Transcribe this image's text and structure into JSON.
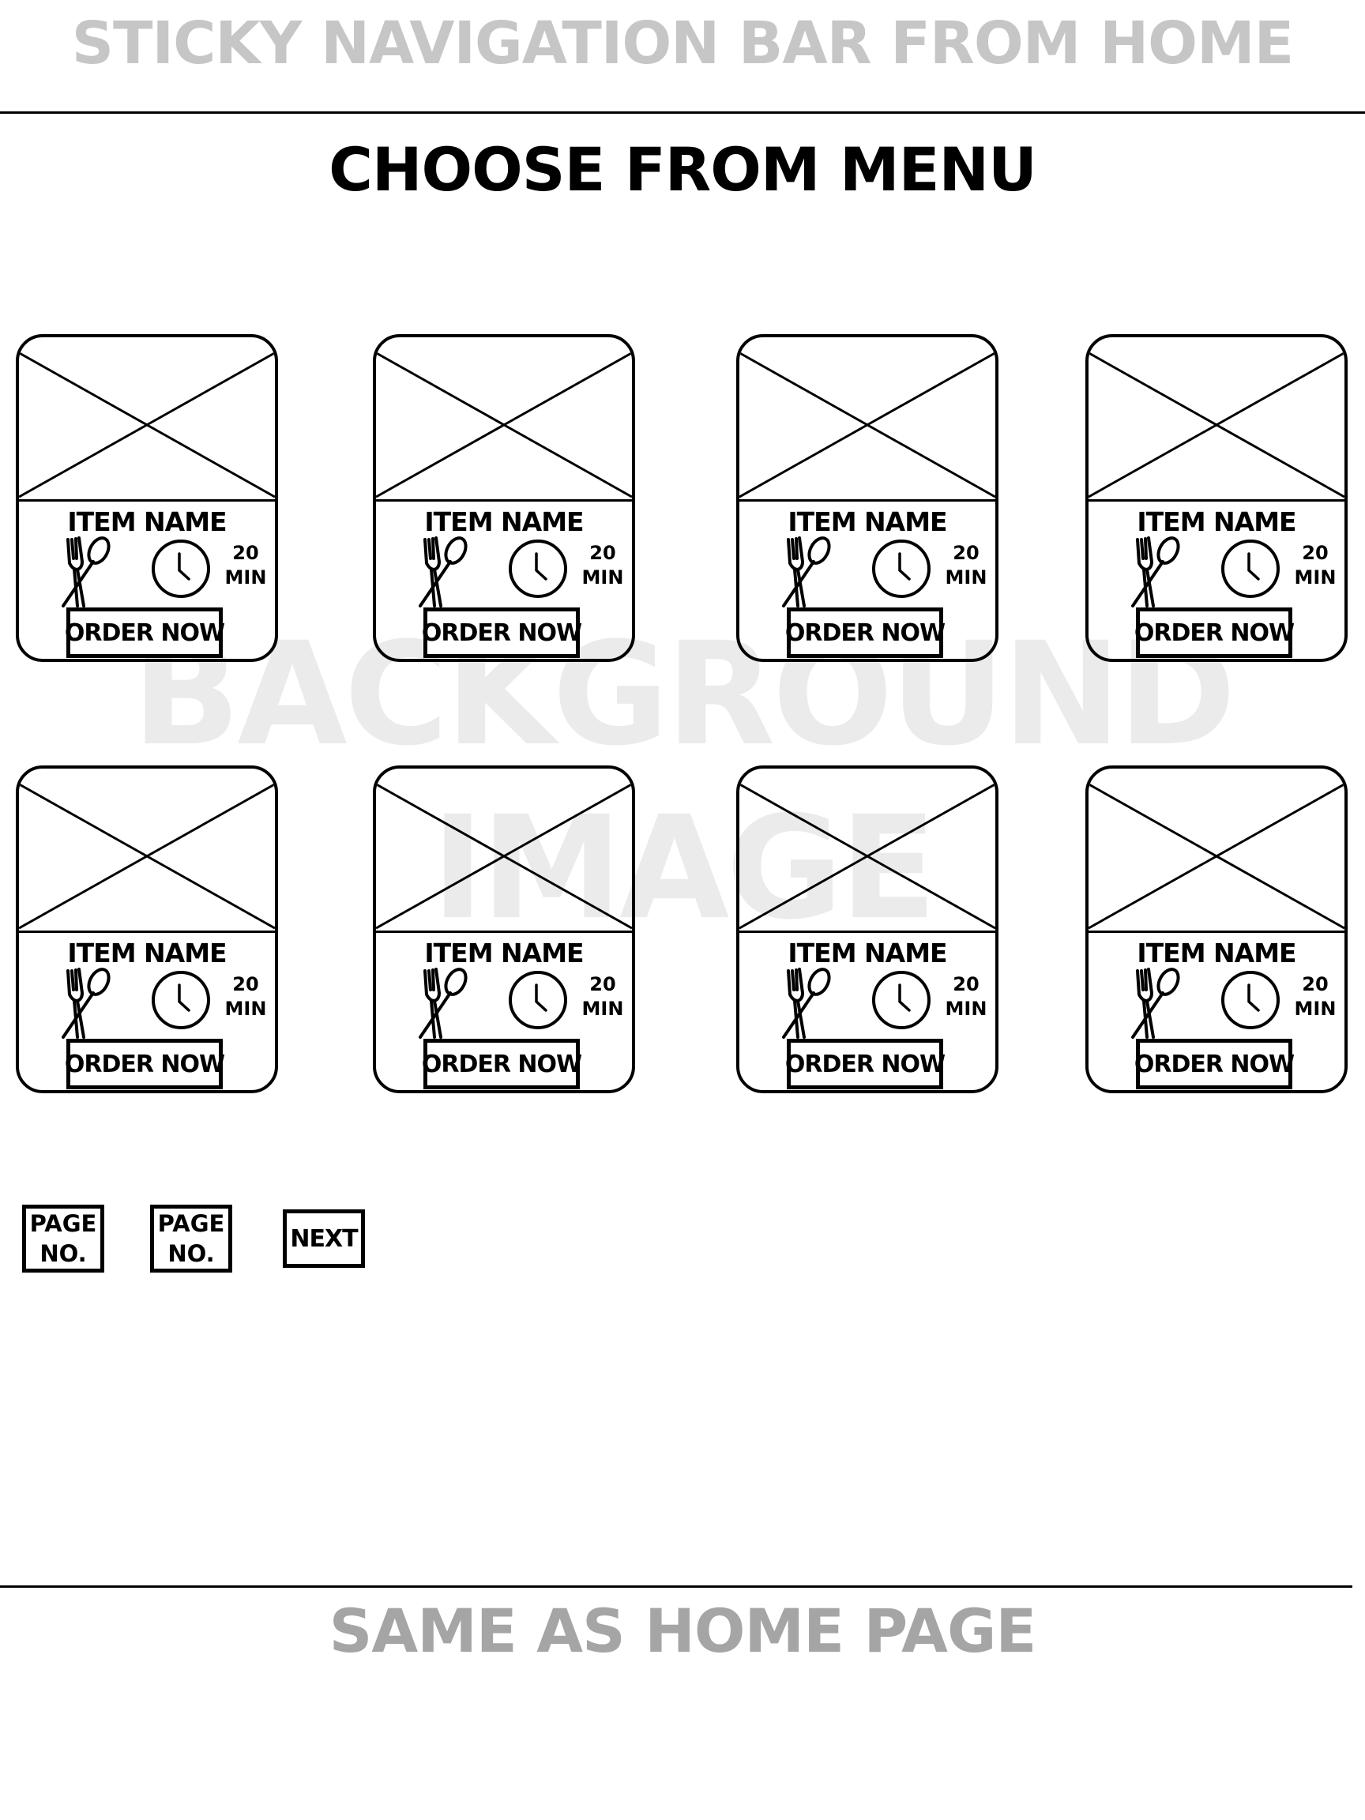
{
  "header": {
    "nav_note": "STICKY NAVIGATION BAR FROM HOME"
  },
  "main": {
    "title": "CHOOSE FROM MENU",
    "background_note": [
      "BACKGROUND",
      "IMAGE"
    ],
    "cards": [
      {
        "item_name": "ITEM NAME",
        "time_value": "20",
        "time_unit": "MIN",
        "order_label": "ORDER NOW"
      },
      {
        "item_name": "ITEM NAME",
        "time_value": "20",
        "time_unit": "MIN",
        "order_label": "ORDER NOW"
      },
      {
        "item_name": "ITEM NAME",
        "time_value": "20",
        "time_unit": "MIN",
        "order_label": "ORDER NOW"
      },
      {
        "item_name": "ITEM NAME",
        "time_value": "20",
        "time_unit": "MIN",
        "order_label": "ORDER NOW"
      },
      {
        "item_name": "ITEM NAME",
        "time_value": "20",
        "time_unit": "MIN",
        "order_label": "ORDER NOW"
      },
      {
        "item_name": "ITEM NAME",
        "time_value": "20",
        "time_unit": "MIN",
        "order_label": "ORDER NOW"
      },
      {
        "item_name": "ITEM NAME",
        "time_value": "20",
        "time_unit": "MIN",
        "order_label": "ORDER NOW"
      },
      {
        "item_name": "ITEM NAME",
        "time_value": "20",
        "time_unit": "MIN",
        "order_label": "ORDER NOW"
      }
    ],
    "icons": {
      "food": "fork-spoon-icon",
      "time": "clock-icon"
    }
  },
  "pagination": {
    "pages": [
      {
        "line1": "PAGE",
        "line2": "NO."
      },
      {
        "line1": "PAGE",
        "line2": "NO."
      }
    ],
    "next_label": "NEXT"
  },
  "footer": {
    "note": "SAME AS HOME PAGE"
  },
  "colors": {
    "line": "#000000",
    "nav_note": "#c6c6c6",
    "footer_note": "#a5a5a5",
    "watermark": "#ebebeb"
  }
}
